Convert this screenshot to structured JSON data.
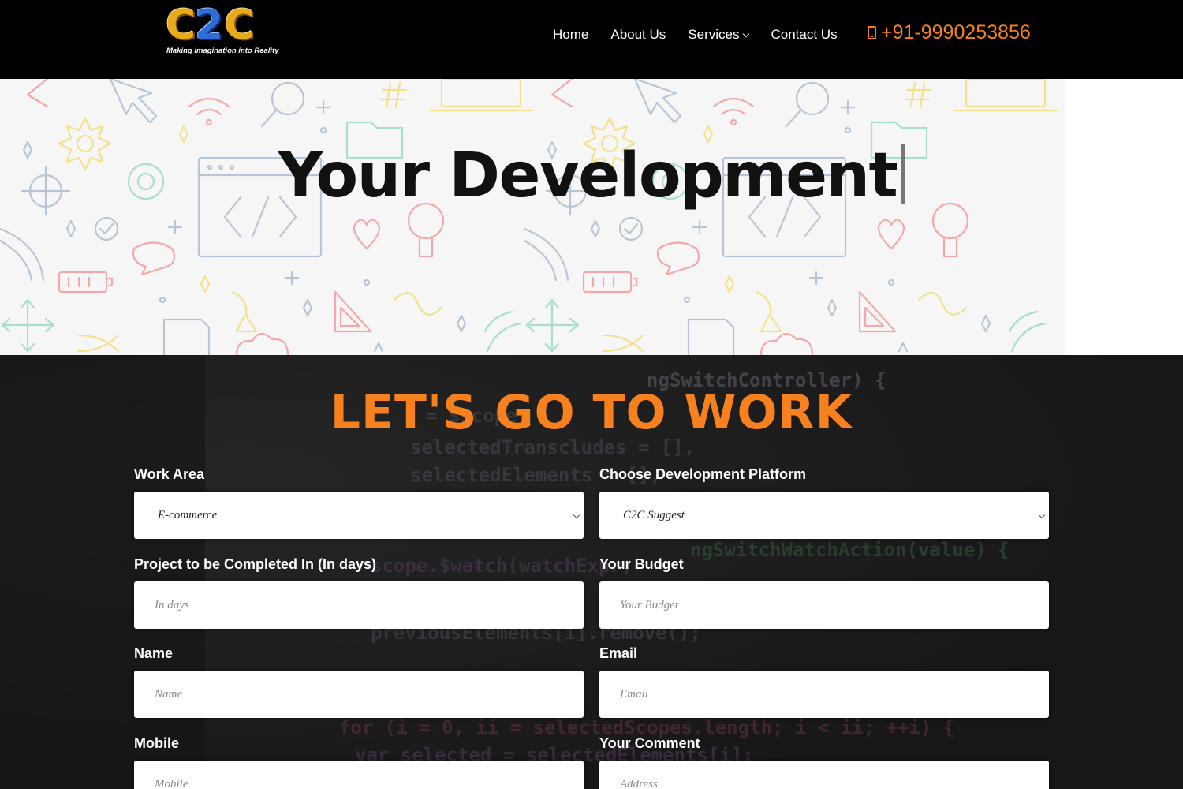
{
  "header": {
    "logo_text": "C2C",
    "logo_tagline": "Making imagination into Reality",
    "nav": [
      {
        "label": "Home"
      },
      {
        "label": "About Us"
      },
      {
        "label": "Services"
      },
      {
        "label": "Contact Us"
      }
    ],
    "phone": "+91-9990253856"
  },
  "hero": {
    "title": "Your Development"
  },
  "work_form": {
    "title": "LET'S GO TO WORK",
    "work_area": {
      "label": "Work Area",
      "value": "E-commerce"
    },
    "platform": {
      "label": "Choose Development Platform",
      "value": "C2C Suggest"
    },
    "days": {
      "label": "Project to be Completed In (In days)",
      "placeholder": "In days"
    },
    "budget": {
      "label": "Your Budget",
      "placeholder": "Your Budget"
    },
    "name": {
      "label": "Name",
      "placeholder": "Name"
    },
    "email": {
      "label": "Email",
      "placeholder": "Email"
    },
    "mobile": {
      "label": "Mobile",
      "placeholder": "Mobile"
    },
    "comment": {
      "label": "Your Comment",
      "placeholder": "Address"
    }
  },
  "colors": {
    "header_bg": "#000000",
    "accent": "#f7811e",
    "form_bg": "#2b2b2b"
  }
}
